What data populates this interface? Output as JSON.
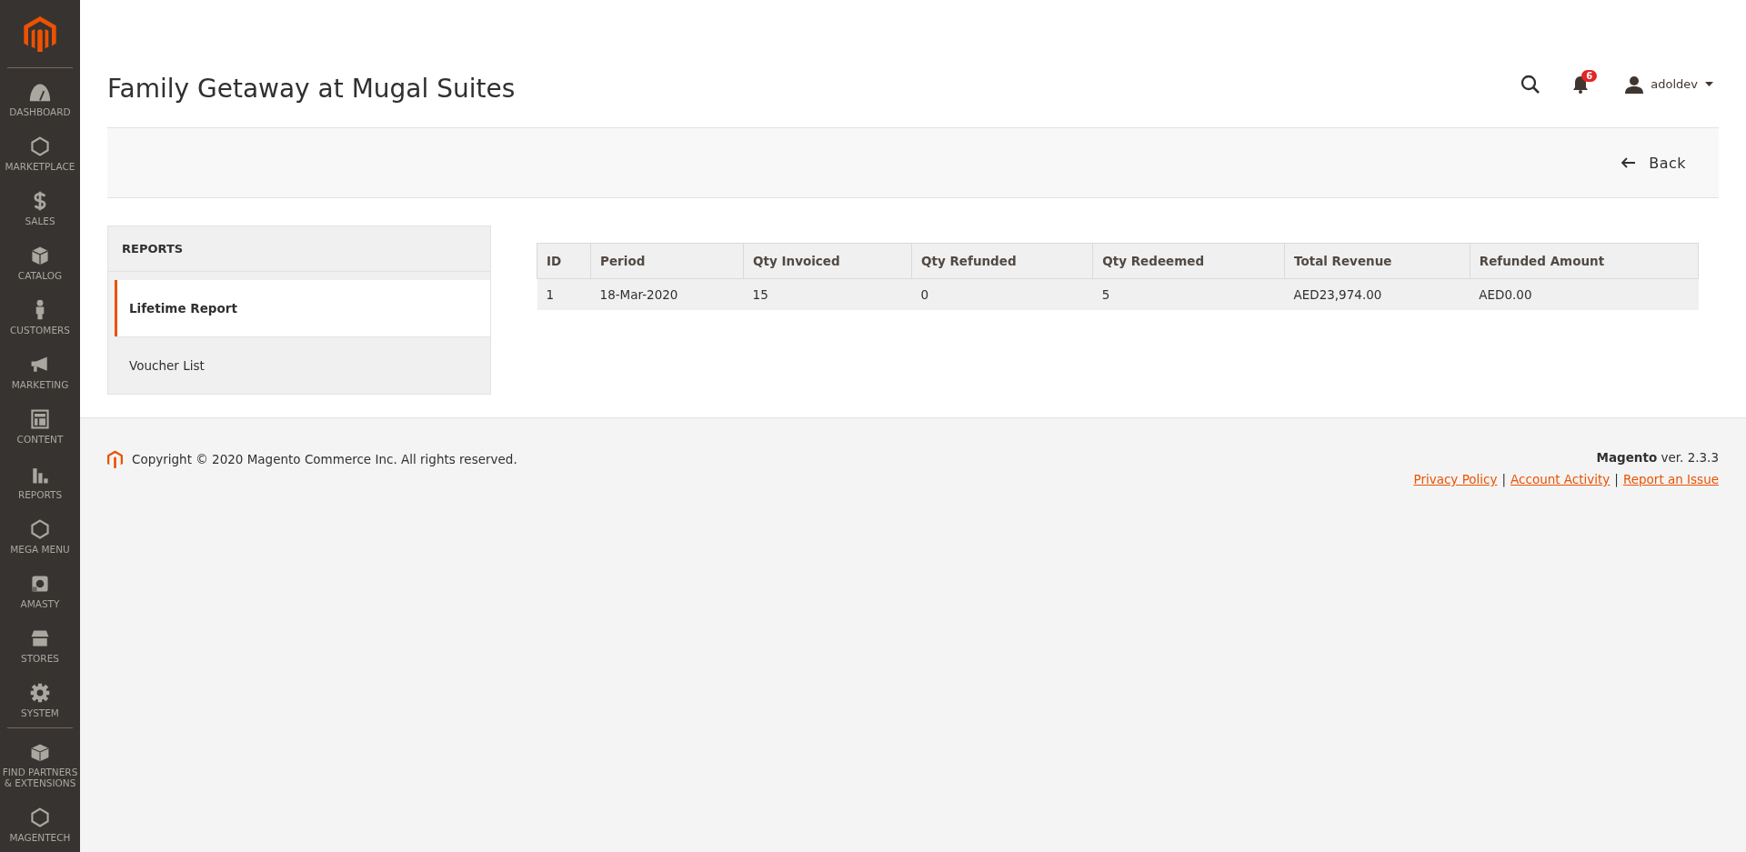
{
  "sidebar": {
    "items": [
      {
        "label": "DASHBOARD"
      },
      {
        "label": "MARKETPLACE"
      },
      {
        "label": "SALES"
      },
      {
        "label": "CATALOG"
      },
      {
        "label": "CUSTOMERS"
      },
      {
        "label": "MARKETING"
      },
      {
        "label": "CONTENT"
      },
      {
        "label": "REPORTS"
      },
      {
        "label": "MEGA MENU"
      },
      {
        "label": "AMASTY"
      },
      {
        "label": "STORES"
      },
      {
        "label": "SYSTEM"
      },
      {
        "label": "FIND PARTNERS & EXTENSIONS"
      },
      {
        "label": "MAGENTECH"
      }
    ]
  },
  "header": {
    "title": "Family Getaway at Mugal Suites",
    "notifications": "6",
    "user": "adoldev"
  },
  "actions": {
    "back": "Back"
  },
  "reports_panel": {
    "title": "REPORTS",
    "tabs": [
      {
        "label": "Lifetime Report",
        "selected": true
      },
      {
        "label": "Voucher List",
        "selected": false
      }
    ]
  },
  "table": {
    "columns": [
      "ID",
      "Period",
      "Qty Invoiced",
      "Qty Refunded",
      "Qty Redeemed",
      "Total Revenue",
      "Refunded Amount"
    ],
    "rows": [
      [
        "1",
        "18-Mar-2020",
        "15",
        "0",
        "5",
        "AED23,974.00",
        "AED0.00"
      ]
    ]
  },
  "footer": {
    "copyright": "Copyright © 2020 Magento Commerce Inc. All rights reserved.",
    "version": "**Magento** ver. 2.3.3",
    "links": [
      "Privacy Policy",
      "Account Activity",
      "Report an Issue"
    ],
    "separator": "|"
  }
}
